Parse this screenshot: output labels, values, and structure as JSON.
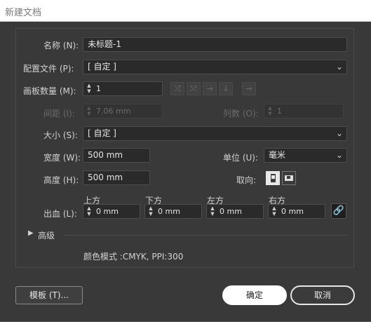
{
  "window": {
    "title": "新建文档"
  },
  "name": {
    "label": "名称 (N):",
    "value": "未标题-1"
  },
  "profile": {
    "label": "配置文件 (P):",
    "value": "[ 自定 ]"
  },
  "artboards": {
    "label": "画板数量 (M):",
    "value": "1"
  },
  "spacing": {
    "label": "间距 (I):",
    "value": "7.06 mm"
  },
  "columns": {
    "label": "列数 (O):",
    "value": "1"
  },
  "artboard_layout_icons": [
    "grid-by-row-icon",
    "grid-by-column-icon",
    "arrange-by-row-icon",
    "arrange-by-column-icon",
    "right-to-left-icon"
  ],
  "size": {
    "label": "大小 (S):",
    "value": "[ 自定 ]"
  },
  "width": {
    "label": "宽度 (W):",
    "value": "500 mm"
  },
  "units": {
    "label": "单位 (U):",
    "value": "毫米"
  },
  "height": {
    "label": "高度 (H):",
    "value": "500 mm"
  },
  "orientation": {
    "label": "取向:",
    "selected": "portrait"
  },
  "bleed": {
    "label": "出血 (L):",
    "top": {
      "label": "上方",
      "value": "0 mm"
    },
    "bottom": {
      "label": "下方",
      "value": "0 mm"
    },
    "left": {
      "label": "左方",
      "value": "0 mm"
    },
    "right": {
      "label": "右方",
      "value": "0 mm"
    }
  },
  "advanced": {
    "label": "高级"
  },
  "color_info": "颜色模式 :CMYK, PPI:300",
  "buttons": {
    "templates": "模板 (T)...",
    "ok": "确定",
    "cancel": "取消"
  }
}
